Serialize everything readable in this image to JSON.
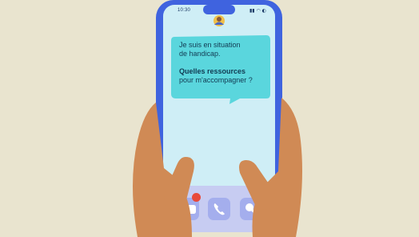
{
  "status_bar": {
    "time": "10:30",
    "icons": "▮▮ ◠ ◐"
  },
  "message": {
    "line1": "Je suis en situation",
    "line2": "de handicap.",
    "line3_bold": "Quelles ressources",
    "line4": "pour m'accompagner ?"
  },
  "dock": {
    "items": [
      {
        "icon": "chat-bubble-icon",
        "notification": true
      },
      {
        "icon": "phone-icon"
      },
      {
        "icon": "search-icon"
      }
    ]
  },
  "colors": {
    "background": "#e9e4cf",
    "phone": "#3f63df",
    "screen": "#cfeef6",
    "bubble": "#5ad6dd",
    "skin": "#d08a55",
    "badge": "#e8493a"
  }
}
